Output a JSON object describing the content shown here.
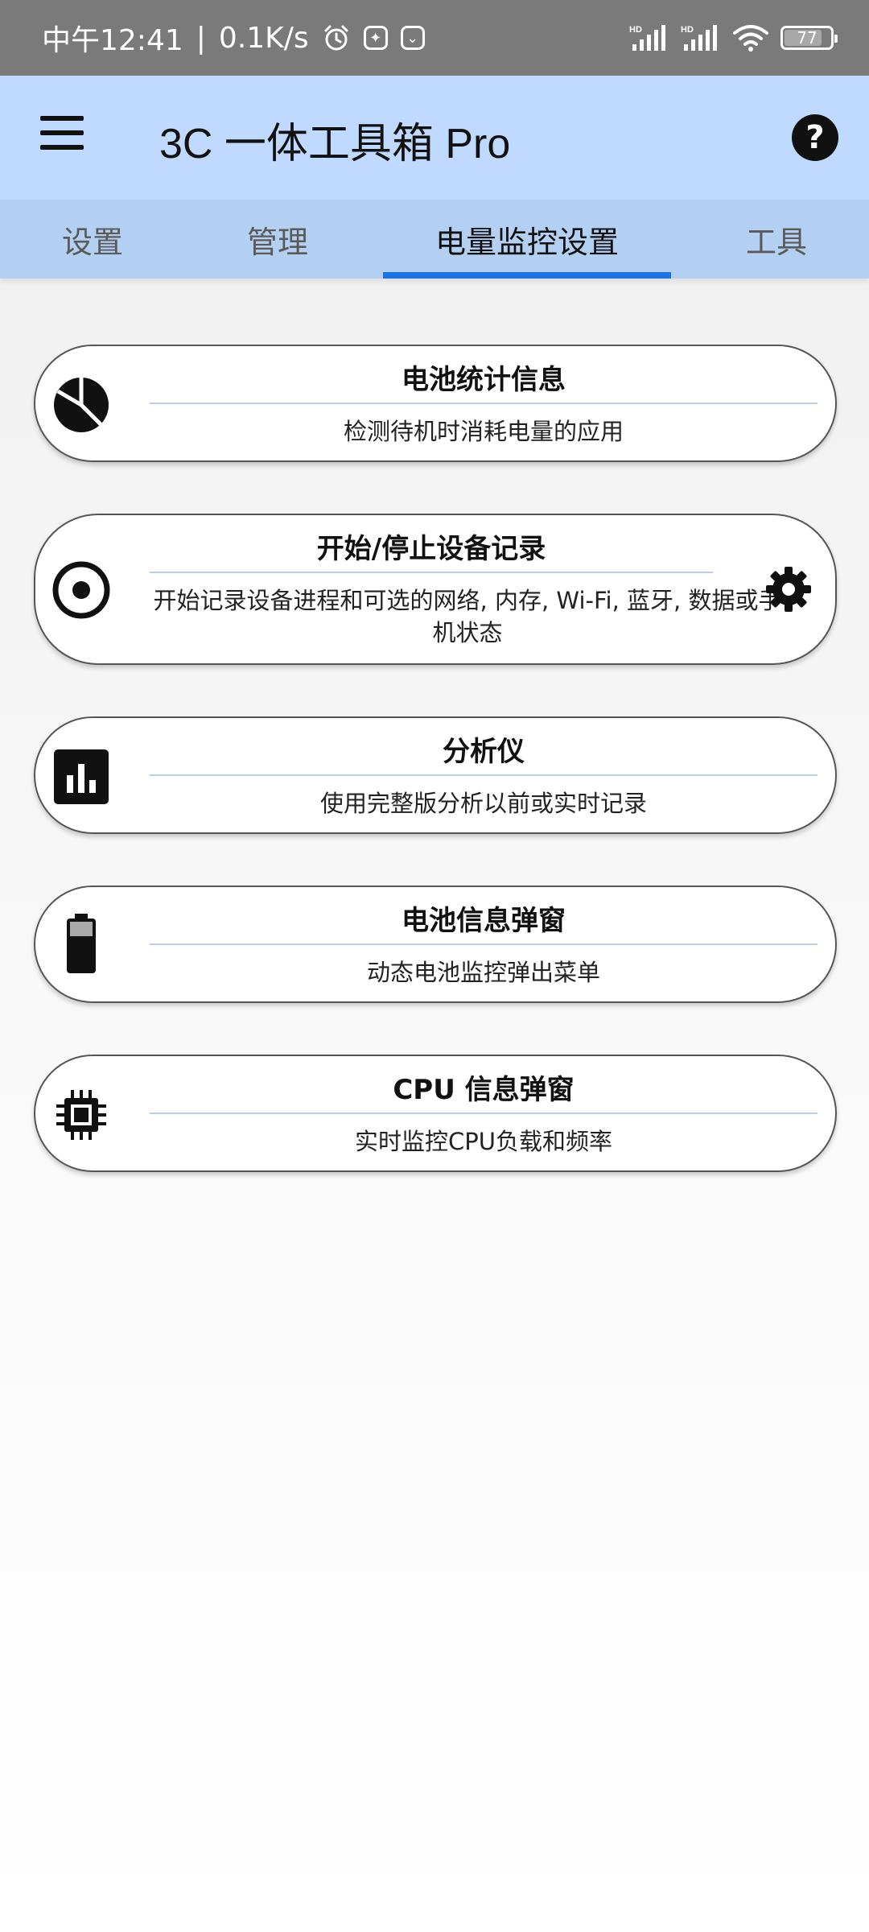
{
  "status_bar": {
    "time": "中午12:41",
    "speed": "0.1K/s",
    "battery": "77"
  },
  "app_bar": {
    "title": "3C 一体工具箱 Pro"
  },
  "tabs": [
    {
      "label": "设置"
    },
    {
      "label": "管理"
    },
    {
      "label": "电量监控设置"
    },
    {
      "label": "工具"
    }
  ],
  "cards": [
    {
      "title": "电池统计信息",
      "subtitle": "检测待机时消耗电量的应用",
      "icon": "pie-chart-icon"
    },
    {
      "title": "开始/停止设备记录",
      "subtitle": "开始记录设备进程和可选的网络, 内存, Wi-Fi, 蓝牙, 数据或手机状态",
      "icon": "record-icon"
    },
    {
      "title": "分析仪",
      "subtitle": "使用完整版分析以前或实时记录",
      "icon": "bar-chart-icon"
    },
    {
      "title": "电池信息弹窗",
      "subtitle": "动态电池监控弹出菜单",
      "icon": "battery-icon"
    },
    {
      "title": "CPU 信息弹窗",
      "subtitle": "实时监控CPU负载和频率",
      "icon": "cpu-icon"
    }
  ],
  "colors": {
    "app_bar": "#c0d9ff",
    "tab_bar": "#b3cff1",
    "tab_indicator": "#1a73e8"
  }
}
